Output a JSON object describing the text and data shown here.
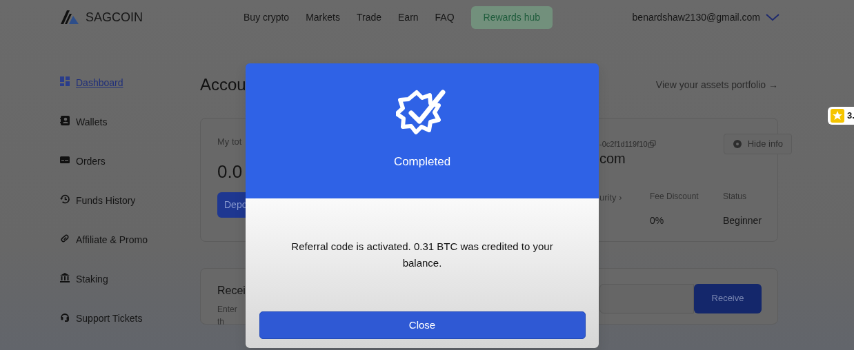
{
  "header": {
    "brand": "SAGCOIN",
    "nav": [
      {
        "label": "Buy crypto"
      },
      {
        "label": "Markets"
      },
      {
        "label": "Trade"
      },
      {
        "label": "Earn"
      },
      {
        "label": "FAQ"
      }
    ],
    "rewards_button": "Rewards hub",
    "account_email": "benardshaw2130@gmail.com"
  },
  "sidebar": {
    "items": [
      {
        "label": "Dashboard",
        "kind": "grid",
        "selected": true
      },
      {
        "label": "Wallets",
        "kind": "contacts",
        "selected": false
      },
      {
        "label": "Orders",
        "kind": "card",
        "selected": false
      },
      {
        "label": "Funds History",
        "kind": "history",
        "selected": false
      },
      {
        "label": "Affiliate & Promo",
        "kind": "link",
        "selected": false
      },
      {
        "label": "Staking",
        "kind": "bank",
        "selected": false
      },
      {
        "label": "Support Tickets",
        "kind": "headset",
        "selected": false
      }
    ]
  },
  "main": {
    "title": "Accou",
    "portfolio_link": "View your assets portfolio →",
    "balance_card": {
      "label": "My tot",
      "amount": "0.0",
      "deposit_button": "Depo",
      "uid": "-0c2f1d119f10",
      "hide_info_button": "Hide info",
      "email": "com",
      "security_link": "urity ›",
      "stats": [
        {
          "label": "Fee Discount",
          "value": "0%"
        },
        {
          "label": "Status",
          "value": "Beginner"
        }
      ]
    },
    "receive_card": {
      "title": "Recei",
      "hint": "Enter th",
      "button": "Receive"
    }
  },
  "rating_badge": {
    "text": "3."
  },
  "modal": {
    "title": "Completed",
    "message": "Referral code is activated. 0.31 BTC was credited to your balance.",
    "button": "Close"
  }
}
